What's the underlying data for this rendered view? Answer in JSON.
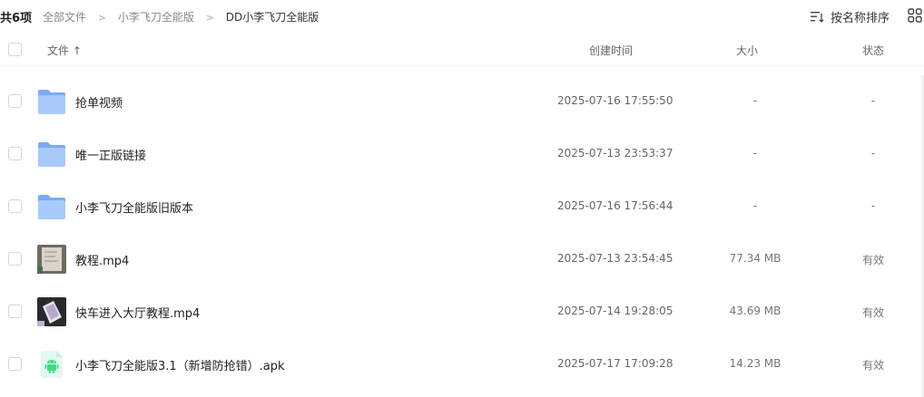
{
  "toolbar": {
    "count": "共6项",
    "breadcrumb": [
      "全部文件",
      "小李飞刀全能版",
      "DD小李飞刀全能版"
    ],
    "sort_label": "按名称排序"
  },
  "table": {
    "headers": {
      "name": "文件 ↑",
      "time": "创建时间",
      "size": "大小",
      "status": "状态"
    },
    "rows": [
      {
        "name": "抢单视频",
        "time": "2025-07-16 17:55:50",
        "size": "-",
        "status": "-",
        "icon": "folder-icon"
      },
      {
        "name": "唯一正版链接",
        "time": "2025-07-13 23:53:37",
        "size": "-",
        "status": "-",
        "icon": "folder-icon"
      },
      {
        "name": "小李飞刀全能版旧版本",
        "time": "2025-07-16 17:56:44",
        "size": "-",
        "status": "-",
        "icon": "folder-icon"
      },
      {
        "name": "教程.mp4",
        "time": "2025-07-13 23:54:45",
        "size": "77.34 MB",
        "status": "有效",
        "icon": "video-thumbnail"
      },
      {
        "name": "快车进入大厅教程.mp4",
        "time": "2025-07-14 19:28:05",
        "size": "43.69 MB",
        "status": "有效",
        "icon": "video-thumbnail"
      },
      {
        "name": "小李飞刀全能版3.1（新增防抢错）.apk",
        "time": "2025-07-17 17:09:28",
        "size": "14.23 MB",
        "status": "有效",
        "icon": "android-apk-icon"
      }
    ]
  },
  "colors": {
    "folder": "#7aaaf6",
    "folder_light": "#a9c9fb",
    "apk_bg": "#e4f8ef",
    "android": "#3ddc84"
  }
}
